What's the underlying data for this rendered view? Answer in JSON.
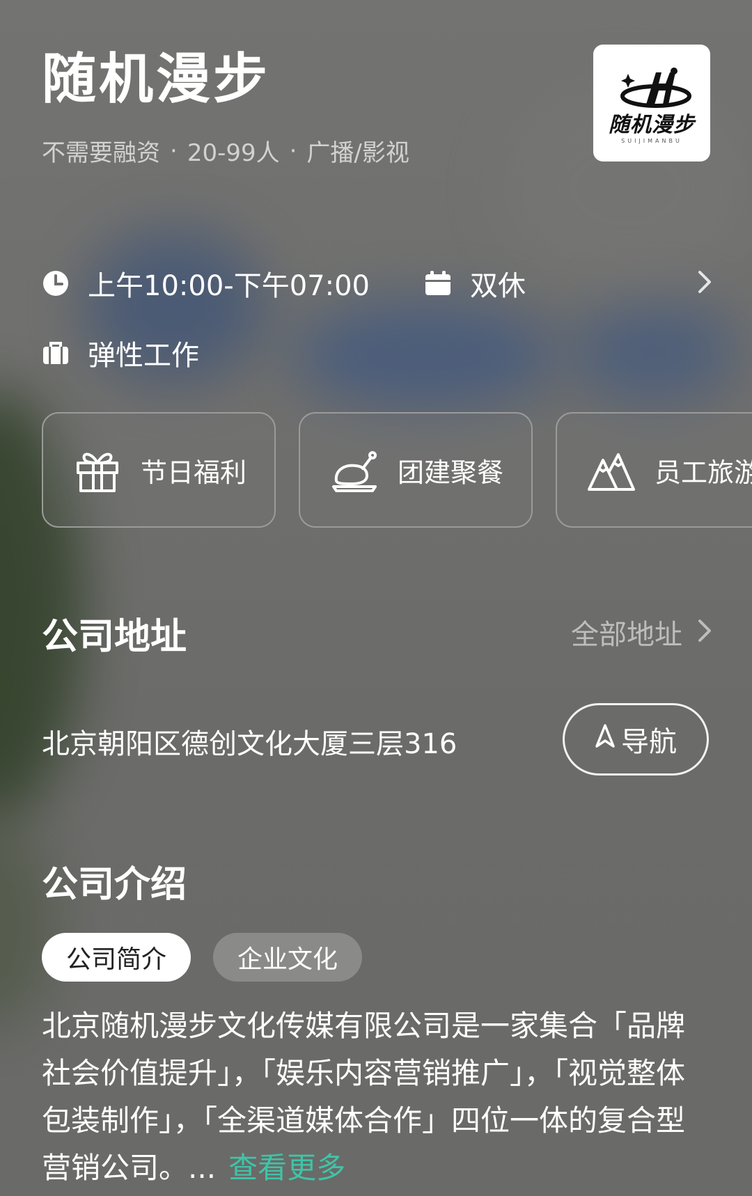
{
  "company": {
    "name": "随机漫步",
    "tags": [
      "不需要融资",
      "20-99人",
      "广播/影视"
    ],
    "separator": "·",
    "logo": {
      "text": "随机漫步",
      "subtext": "SUIJIMANBU"
    }
  },
  "work_info": {
    "hours": "上午10:00-下午07:00",
    "rest": "双休",
    "mode": "弹性工作"
  },
  "benefits": [
    {
      "label": "节日福利",
      "icon": "gift-icon"
    },
    {
      "label": "团建聚餐",
      "icon": "roast-chicken-icon"
    },
    {
      "label": "员工旅游",
      "icon": "mountain-icon"
    }
  ],
  "address": {
    "section_title": "公司地址",
    "all_link": "全部地址",
    "text": "北京朝阳区德创文化大厦三层316",
    "nav_button": "导航"
  },
  "intro": {
    "section_title": "公司介绍",
    "tabs": [
      "公司简介",
      "企业文化"
    ],
    "active_tab": 0,
    "description": "北京随机漫步文化传媒有限公司是一家集合「品牌社会价值提升」，「娱乐内容营销推广」，「视觉整体包装制作」，「全渠道媒体合作」四位一体的复合型营销公司。...",
    "more_link": "查看更多"
  },
  "colors": {
    "accent": "#3fc4a8",
    "background": "#6e6e6c",
    "muted_text": "#bdbdbb"
  }
}
